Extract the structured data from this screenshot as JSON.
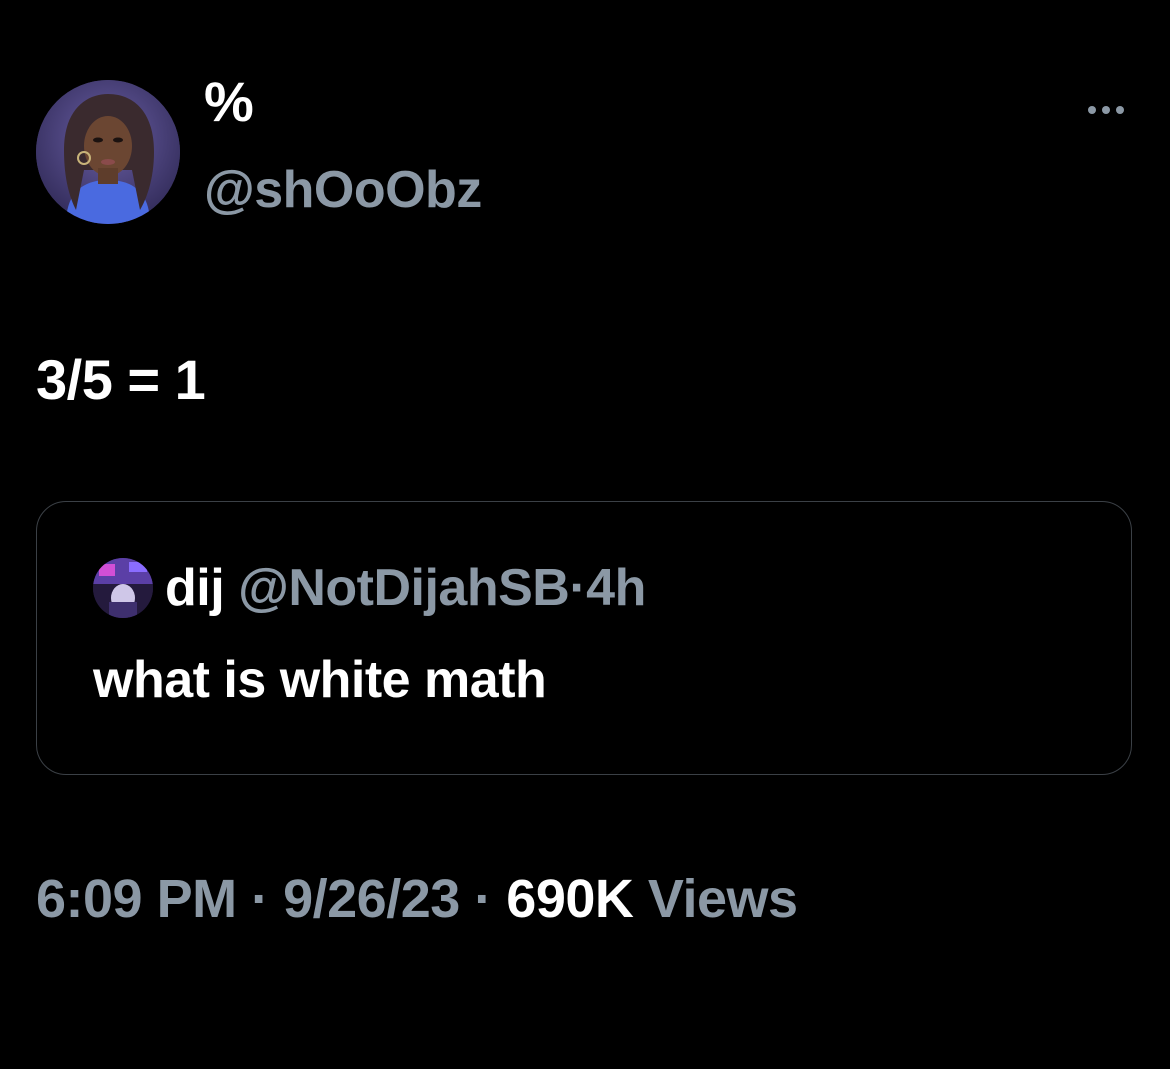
{
  "author": {
    "display_name": "%",
    "handle": "@shOoObz"
  },
  "tweet": {
    "text": "3/5 = 1"
  },
  "quoted_tweet": {
    "display_name": "dij",
    "handle": "@NotDijahSB",
    "separator": "·",
    "time_ago": "4h",
    "text": "what is white math"
  },
  "meta": {
    "time": "6:09 PM",
    "separator": "·",
    "date": "9/26/23",
    "views_count": "690K",
    "views_label": "Views"
  },
  "icons": {
    "more": "more-horizontal-icon",
    "avatar": "user-avatar",
    "quote_avatar": "quoted-user-avatar"
  },
  "colors": {
    "background": "#000000",
    "primary_text": "#ffffff",
    "secondary_text": "#8b98a5",
    "border": "#3b4046"
  }
}
